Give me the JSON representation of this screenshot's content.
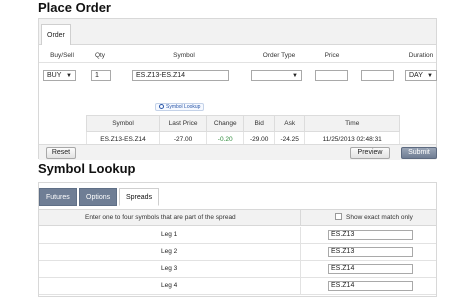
{
  "place_order": {
    "title": "Place Order",
    "tab_label": "Order",
    "columns": [
      "Buy/Sell",
      "Qty",
      "Symbol",
      "Order Type",
      "Price",
      "Duration"
    ],
    "buy_sell": "BUY",
    "qty": "1",
    "symbol": "ES.Z13-ES.Z14",
    "symbol_lookup_label": "Symbol Lookup",
    "order_type": "",
    "price1": "",
    "price2": "",
    "duration": "DAY"
  },
  "quote": {
    "headers": [
      "Symbol",
      "Last Price",
      "Change",
      "Bid",
      "Ask",
      "Time"
    ],
    "row": {
      "symbol": "ES.Z13-ES.Z14",
      "last_price": "-27.00",
      "change": "-0.20",
      "bid": "-29.00",
      "ask": "-24.25",
      "time": "11/25/2013 02:48:31"
    }
  },
  "actions": {
    "reset": "Reset",
    "preview": "Preview",
    "submit": "Submit"
  },
  "symbol_lookup": {
    "title": "Symbol Lookup",
    "tabs": [
      "Futures",
      "Options",
      "Spreads"
    ],
    "instruction": "Enter one to four symbols that are part of the spread",
    "exact_match_label": "Show exact match only",
    "legs": [
      {
        "label": "Leg 1",
        "value": "ES.Z13"
      },
      {
        "label": "Leg 2",
        "value": "ES.Z13"
      },
      {
        "label": "Leg 3",
        "value": "ES.Z14"
      },
      {
        "label": "Leg 4",
        "value": "ES.Z14"
      }
    ]
  },
  "colors": {
    "tab_active_dark": "#6f7e95",
    "submit_bg": "#7a879c",
    "change_green": "#2e8a3a"
  }
}
